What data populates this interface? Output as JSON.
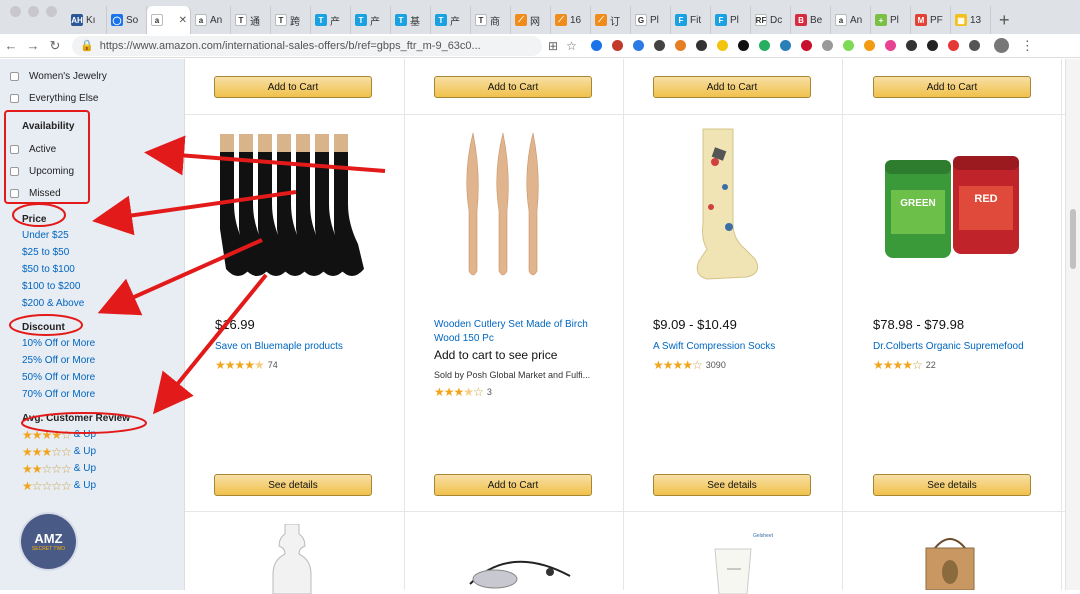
{
  "browser": {
    "tabs": [
      {
        "label": "Kı",
        "favicon": "#2b5797",
        "glyph": "AH"
      },
      {
        "label": "So",
        "favicon": "#1a73e8",
        "glyph": "◯"
      },
      {
        "label": "",
        "favicon": "#fff",
        "glyph": "a",
        "active": true
      },
      {
        "label": "An",
        "favicon": "#fff",
        "glyph": "a"
      },
      {
        "label": "通",
        "favicon": "#fff",
        "glyph": "T"
      },
      {
        "label": "跨",
        "favicon": "#fff",
        "glyph": "T"
      },
      {
        "label": "产",
        "favicon": "#1aa1e1",
        "glyph": "T"
      },
      {
        "label": "产",
        "favicon": "#1aa1e1",
        "glyph": "T"
      },
      {
        "label": "基",
        "favicon": "#1aa1e1",
        "glyph": "T"
      },
      {
        "label": "产",
        "favicon": "#1aa1e1",
        "glyph": "T"
      },
      {
        "label": "商",
        "favicon": "#fff",
        "glyph": "T"
      },
      {
        "label": "网",
        "favicon": "#f08c1c",
        "glyph": "⟋"
      },
      {
        "label": "16",
        "favicon": "#f08c1c",
        "glyph": "⟋"
      },
      {
        "label": "订",
        "favicon": "#f08c1c",
        "glyph": "⟋"
      },
      {
        "label": "Pl",
        "favicon": "#fff",
        "glyph": "G"
      },
      {
        "label": "Fit",
        "favicon": "#1aa1e1",
        "glyph": "F"
      },
      {
        "label": "Pl",
        "favicon": "#1aa1e1",
        "glyph": "F"
      },
      {
        "label": "Dc",
        "favicon": "#fff",
        "glyph": "RF"
      },
      {
        "label": "Be",
        "favicon": "#d62d3e",
        "glyph": "B"
      },
      {
        "label": "An",
        "favicon": "#fff",
        "glyph": "a"
      },
      {
        "label": "Pl",
        "favicon": "#7ac143",
        "glyph": "+"
      },
      {
        "label": "PF",
        "favicon": "#e34234",
        "glyph": "M"
      },
      {
        "label": "13",
        "favicon": "#f3c11c",
        "glyph": "▦"
      }
    ],
    "close_glyph": "✕",
    "new_tab_glyph": "+",
    "url": "https://www.amazon.com/international-sales-offers/b/ref=gbps_ftr_m-9_63c0...",
    "extension_colors": [
      "#1a73e8",
      "#c0392b",
      "#2c7be5",
      "#444",
      "#e67e22",
      "#333",
      "#f1c40f",
      "#111",
      "#27ae60",
      "#2980b9",
      "#c8102e",
      "#999",
      "#7ed957",
      "#f39c12",
      "#e84393",
      "#333",
      "#222",
      "#e53935",
      "#555"
    ]
  },
  "sidebar": {
    "top_items": [
      "Women's Jewelry",
      "Everything Else"
    ],
    "availability": {
      "heading": "Availability",
      "items": [
        "Active",
        "Upcoming",
        "Missed"
      ]
    },
    "price": {
      "heading": "Price",
      "items": [
        "Under $25",
        "$25 to $50",
        "$50 to $100",
        "$100 to $200",
        "$200 & Above"
      ]
    },
    "discount": {
      "heading": "Discount",
      "items": [
        "10% Off or More",
        "25% Off or More",
        "50% Off or More",
        "70% Off or More"
      ]
    },
    "review": {
      "heading": "Avg. Customer Review",
      "rows": [
        {
          "stars": 4,
          "label": "& Up"
        },
        {
          "stars": 3,
          "label": "& Up"
        },
        {
          "stars": 2,
          "label": "& Up"
        },
        {
          "stars": 1,
          "label": "& Up"
        }
      ]
    },
    "badge": {
      "line1": "AMZ",
      "line2": "SECRET TWO"
    }
  },
  "top_buttons": [
    "Add to Cart",
    "Add to Cart",
    "Add to Cart",
    "Add to Cart"
  ],
  "products": [
    {
      "image_icon": "compression-socks-image",
      "price": "$16.99",
      "title": "Save on Bluemaple products",
      "rating": 4.5,
      "reviews": "74",
      "button": "See details"
    },
    {
      "image_icon": "wooden-knives-image",
      "price": "",
      "title": "Wooden Cutlery Set Made of Birch Wood 150 Pc",
      "subtitle": "Add to cart to see price",
      "seller": "Sold by Posh Global Market and Fulfi...",
      "rating": 3.5,
      "reviews": "3",
      "button": "Add to Cart"
    },
    {
      "image_icon": "sock-image",
      "price": "$9.09 - $10.49",
      "title": "A Swift Compression Socks",
      "rating": 4,
      "reviews": "3090",
      "button": "See details"
    },
    {
      "image_icon": "supplement-jars-image",
      "price": "$78.98 - $79.98",
      "title": "Dr.Colberts Organic Supremefood",
      "rating": 4,
      "reviews": "22",
      "button": "See details",
      "jar_labels": [
        "GREEN",
        "RED"
      ]
    }
  ],
  "bottom_row_icons": [
    "bottle-image",
    "headphones-image",
    "tube-product-image",
    "gift-bag-image"
  ],
  "bottom_row_text": {
    "tube_brand": "Gelsheet"
  }
}
